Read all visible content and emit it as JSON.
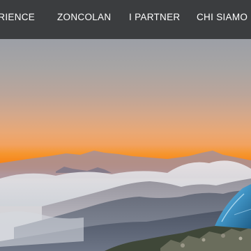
{
  "nav": {
    "items": [
      {
        "label": "ERIENCE"
      },
      {
        "label": "ZONCOLAN"
      },
      {
        "label": "I PARTNER"
      },
      {
        "label": "CHI SIAMO"
      }
    ]
  },
  "colors": {
    "navbar_bg": "#3b3d3f",
    "nav_text": "#ffffff",
    "sunset_orange": "#f7861a",
    "tent": "#3f93c4"
  }
}
